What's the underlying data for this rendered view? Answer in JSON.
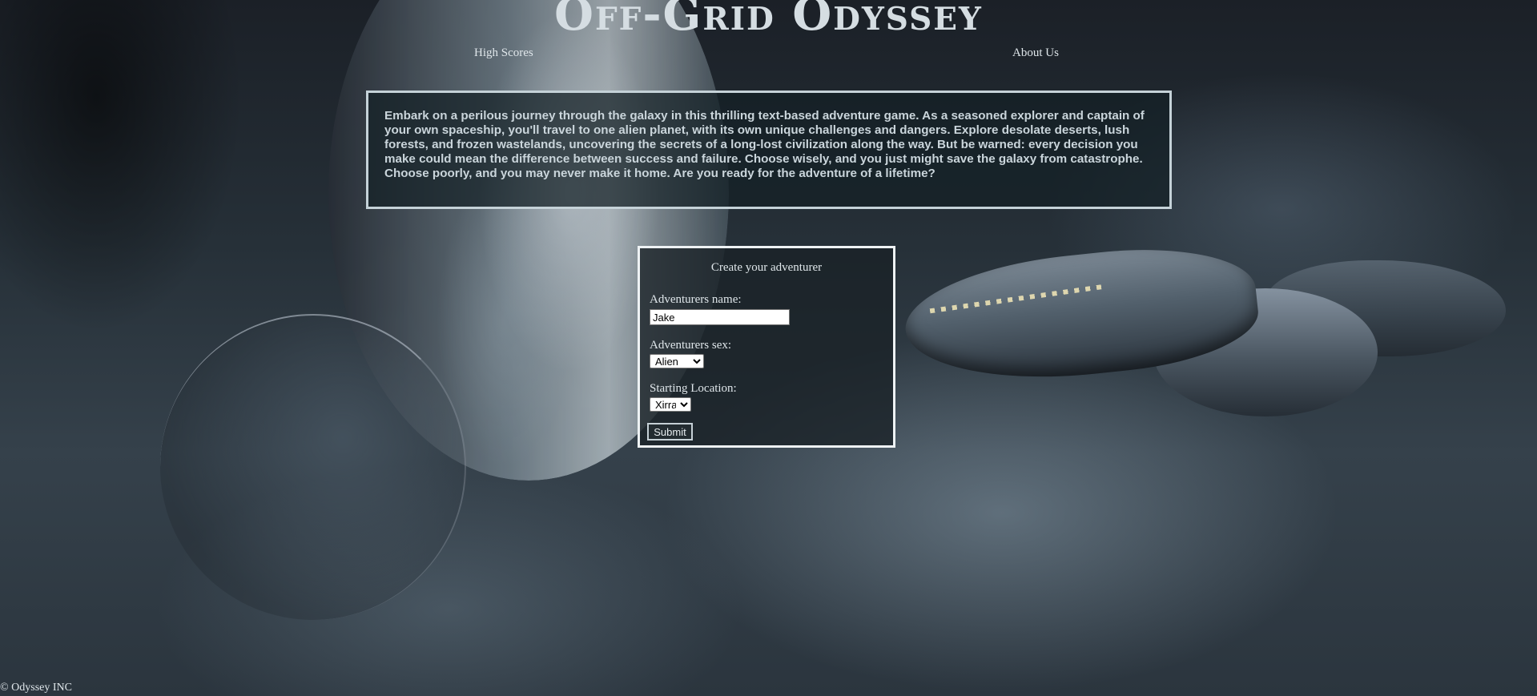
{
  "header": {
    "title": "Off-Grid Odyssey",
    "nav": {
      "high_scores": "High Scores",
      "about_us": "About Us"
    }
  },
  "intro": {
    "text": "Embark on a perilous journey through the galaxy in this thrilling text-based adventure game. As a seasoned explorer and captain of your own spaceship, you'll travel to one alien planet, with its own unique challenges and dangers. Explore desolate deserts, lush forests, and frozen wastelands, uncovering the secrets of a long-lost civilization along the way. But be warned: every decision you make could mean the difference between success and failure. Choose wisely, and you just might save the galaxy from catastrophe. Choose poorly, and you may never make it home. Are you ready for the adventure of a lifetime?"
  },
  "form": {
    "title": "Create your adventurer",
    "name_label": "Adventurers name:",
    "name_value": "Jake",
    "sex_label": "Adventurers sex:",
    "sex_selected": "Alien",
    "location_label": "Starting Location:",
    "location_selected": "Xirra",
    "submit_label": "Submit"
  },
  "footer": {
    "copyright": "© Odyssey INC"
  }
}
